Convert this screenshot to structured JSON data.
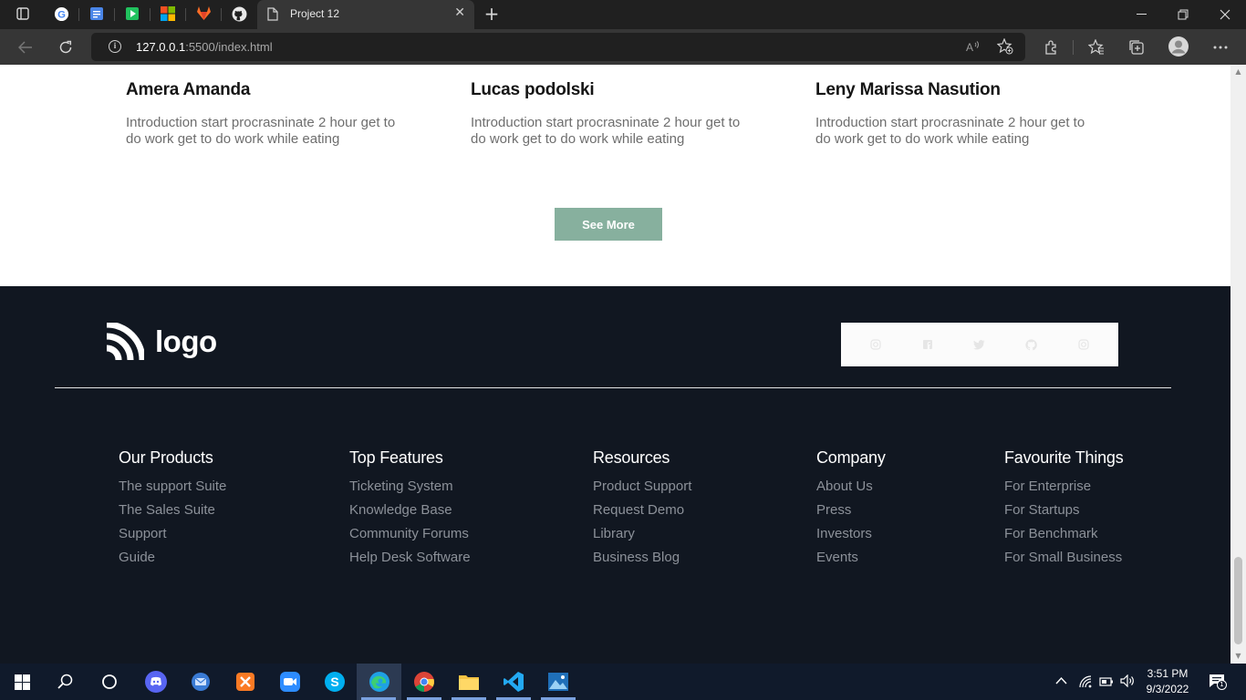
{
  "browser": {
    "tab_title": "Project 12",
    "url_host": "127.0.0.1",
    "url_rest": ":5500/index.html",
    "new_tab_symbol": "+",
    "close_symbol": "✕"
  },
  "testimonials": [
    {
      "name": "Amera Amanda",
      "text": "Introduction start procrasninate 2 hour get to do work get to do work while eating"
    },
    {
      "name": "Lucas podolski",
      "text": "Introduction start procrasninate 2 hour get to do work get to do work while eating"
    },
    {
      "name": "Leny Marissa Nasution",
      "text": "Introduction start procrasninate 2 hour get to do work get to do work while eating"
    }
  ],
  "see_more_label": "See More",
  "footer": {
    "logo_text": "logo",
    "social_icons": [
      "instagram-icon",
      "facebook-icon",
      "twitter-icon",
      "github-icon",
      "instagram-icon"
    ],
    "columns": [
      {
        "title": "Our Products",
        "links": [
          "The support Suite",
          "The Sales Suite",
          "Support",
          "Guide"
        ]
      },
      {
        "title": "Top Features",
        "links": [
          "Ticketing System",
          "Knowledge Base",
          "Community Forums",
          "Help Desk Software"
        ]
      },
      {
        "title": "Resources",
        "links": [
          "Product Support",
          "Request Demo",
          "Library",
          "Business Blog"
        ]
      },
      {
        "title": "Company",
        "links": [
          "About Us",
          "Press",
          "Investors",
          "Events"
        ]
      },
      {
        "title": "Favourite Things",
        "links": [
          "For Enterprise",
          "For Startups",
          "For Benchmark",
          "For Small Business"
        ]
      }
    ]
  },
  "taskbar": {
    "time": "3:51 PM",
    "date": "9/3/2022",
    "notification_count": "1"
  },
  "colors": {
    "accent_button": "#87b09e",
    "footer_bg": "#111721",
    "taskbar_bg": "#101a2b"
  }
}
